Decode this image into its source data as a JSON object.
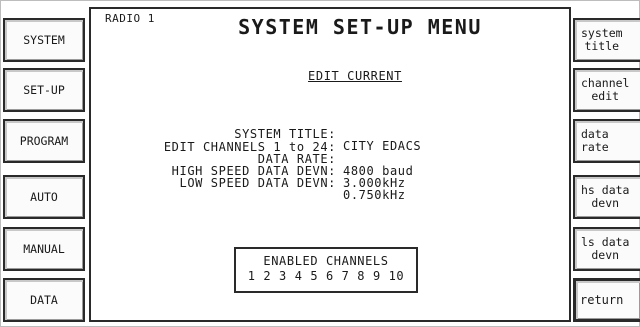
{
  "header": {
    "radio_label": "RADIO 1",
    "menu_title": "SYSTEM SET-UP MENU"
  },
  "left_menu": [
    "SYSTEM",
    "SET-UP",
    "PROGRAM",
    "AUTO",
    "MANUAL",
    "DATA"
  ],
  "right_menu": [
    "system\ntitle",
    "channel\nedit",
    "data\nrate",
    "hs data\ndevn",
    "ls data\ndevn",
    "return"
  ],
  "content": {
    "section_title": "EDIT CURRENT",
    "system_title": {
      "label": "SYSTEM TITLE:",
      "value": "CITY EDACS"
    },
    "edit_channels": {
      "label": "EDIT CHANNELS 1 to 24:",
      "value": ""
    },
    "data_rate": {
      "label": "DATA RATE:",
      "value": "4800 baud"
    },
    "high_speed": {
      "label": "HIGH SPEED DATA DEVN:",
      "value": "3.000kHz"
    },
    "low_speed": {
      "label": "LOW SPEED DATA DEVN:",
      "value": "0.750kHz"
    }
  },
  "enabled_channels": {
    "title": "ENABLED CHANNELS",
    "channels": "1 2 3 4 5 6 7 8 9 10"
  }
}
